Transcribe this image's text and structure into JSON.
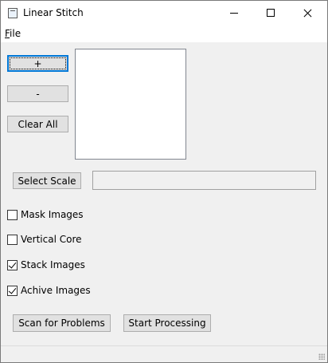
{
  "window": {
    "title": "Linear Stitch"
  },
  "menu": {
    "file_label_first": "F",
    "file_label_rest": "ile"
  },
  "buttons": {
    "add": "+",
    "remove": "-",
    "clear_all": "Clear All",
    "select_scale": "Select Scale",
    "scan": "Scan for Problems",
    "start": "Start Processing"
  },
  "checkboxes": [
    {
      "label": "Mask Images",
      "checked": false
    },
    {
      "label": "Vertical Core",
      "checked": false
    },
    {
      "label": "Stack Images",
      "checked": true
    },
    {
      "label": "Achive Images",
      "checked": true
    }
  ],
  "scale_field": {
    "value": ""
  }
}
